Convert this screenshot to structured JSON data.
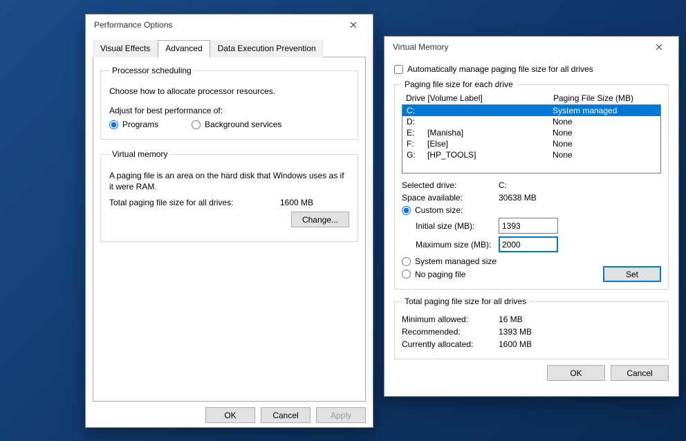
{
  "perf": {
    "title": "Performance Options",
    "tabs": {
      "visual": "Visual Effects",
      "advanced": "Advanced",
      "dep": "Data Execution Prevention"
    },
    "proc": {
      "legend": "Processor scheduling",
      "desc": "Choose how to allocate processor resources.",
      "adjust": "Adjust for best performance of:",
      "programs": "Programs",
      "services": "Background services"
    },
    "vmem": {
      "legend": "Virtual memory",
      "desc": "A paging file is an area on the hard disk that Windows uses as if it were RAM.",
      "total_label": "Total paging file size for all drives:",
      "total_value": "1600 MB",
      "change": "Change..."
    },
    "buttons": {
      "ok": "OK",
      "cancel": "Cancel",
      "apply": "Apply"
    }
  },
  "vm": {
    "title": "Virtual Memory",
    "auto": "Automatically manage paging file size for all drives",
    "drives_legend": "Paging file size for each drive",
    "head_drive": "Drive  [Volume Label]",
    "head_size": "Paging File Size (MB)",
    "rows": [
      {
        "d": "C:",
        "v": "",
        "p": "System managed"
      },
      {
        "d": "D:",
        "v": "",
        "p": "None"
      },
      {
        "d": "E:",
        "v": "[Manisha]",
        "p": "None"
      },
      {
        "d": "F:",
        "v": "[Else]",
        "p": "None"
      },
      {
        "d": "G:",
        "v": "[HP_TOOLS]",
        "p": "None"
      }
    ],
    "selected_label": "Selected drive:",
    "selected_value": "C:",
    "space_label": "Space available:",
    "space_value": "30638 MB",
    "custom": "Custom size:",
    "initial_label": "Initial size (MB):",
    "initial_value": "1393",
    "max_label": "Maximum size (MB):",
    "max_value": "2000",
    "sys_managed": "System managed size",
    "no_paging": "No paging file",
    "set": "Set",
    "totals_legend": "Total paging file size for all drives",
    "min_label": "Minimum allowed:",
    "min_value": "16 MB",
    "rec_label": "Recommended:",
    "rec_value": "1393 MB",
    "cur_label": "Currently allocated:",
    "cur_value": "1600 MB",
    "ok": "OK",
    "cancel": "Cancel"
  }
}
